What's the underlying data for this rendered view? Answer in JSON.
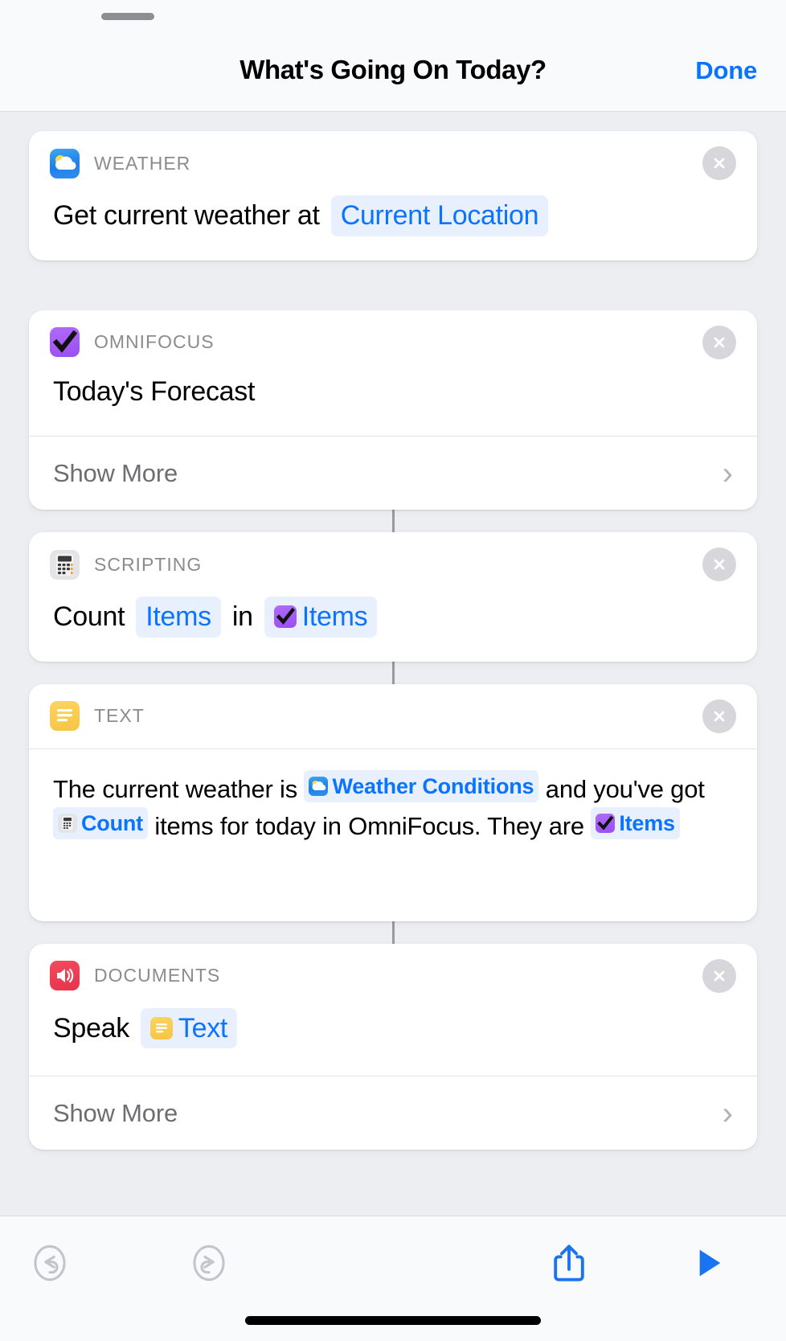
{
  "header": {
    "title": "What's Going On Today?",
    "done_label": "Done"
  },
  "actions": [
    {
      "category": "WEATHER",
      "icon": "weather-icon",
      "line_prefix": "Get current weather at",
      "token": "Current Location",
      "has_show_more": false,
      "show_more_label": ""
    },
    {
      "category": "OMNIFOCUS",
      "icon": "omnifocus-checkmark-icon",
      "line_prefix": "Today's Forecast",
      "token": "",
      "has_show_more": true,
      "show_more_label": "Show More"
    },
    {
      "category": "SCRIPTING",
      "icon": "calculator-icon",
      "line_prefix": "Count",
      "token_a": "Items",
      "line_middle": "in",
      "token_b": "Items",
      "has_show_more": false,
      "show_more_label": ""
    },
    {
      "category": "TEXT",
      "icon": "text-lines-icon",
      "body": {
        "seg1": "The current weather is ",
        "tok1": "Weather Conditions",
        "seg2": " and you've got ",
        "tok2": "Count",
        "seg3": " items for today in OmniFocus. They are ",
        "tok3": "Items"
      },
      "has_show_more": false,
      "show_more_label": ""
    },
    {
      "category": "DOCUMENTS",
      "icon": "speaker-icon",
      "line_prefix": "Speak",
      "token": "Text",
      "has_show_more": true,
      "show_more_label": "Show More"
    }
  ],
  "toolbar": {
    "undo": "undo-icon",
    "redo": "redo-icon",
    "share": "share-icon",
    "play": "play-icon"
  },
  "colors": {
    "accent": "#0a74ff",
    "token_bg": "#e8f0fe",
    "page_bg": "#eceef2",
    "card_bg": "#ffffff",
    "weather": "#2f8fef",
    "omnifocus": "#9a4df2",
    "text_yellow": "#f6c445",
    "documents_red": "#e8344b",
    "label_grey": "#8b8b90"
  }
}
